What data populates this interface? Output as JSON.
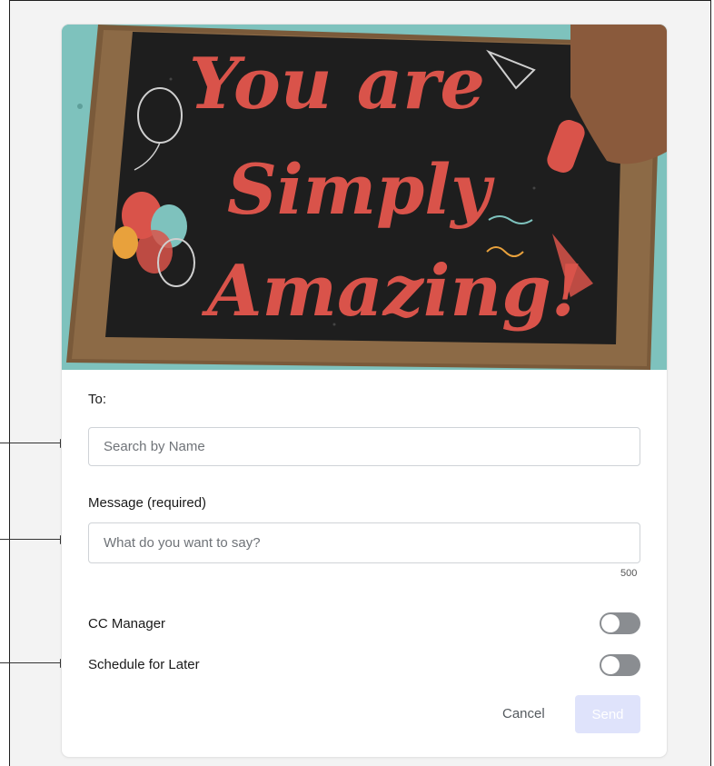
{
  "hero": {
    "line1": "You are",
    "line2": "Simply",
    "line3": "Amazing!"
  },
  "form": {
    "to_label": "To:",
    "to_placeholder": "Search by Name",
    "message_label": "Message (required)",
    "message_placeholder": "What do you want to say?",
    "char_limit": "500",
    "cc_manager_label": "CC Manager",
    "cc_manager_on": false,
    "schedule_label": "Schedule for Later",
    "schedule_on": false,
    "cancel_label": "Cancel",
    "send_label": "Send"
  },
  "colors": {
    "chalk_text": "#d9534a",
    "chalkboard": "#1e1e1e",
    "frame_wood": "#7a5a3a",
    "background_teal": "#7ec2bd",
    "send_disabled_bg": "#dfe3fb",
    "toggle_off": "#8a8d91"
  }
}
